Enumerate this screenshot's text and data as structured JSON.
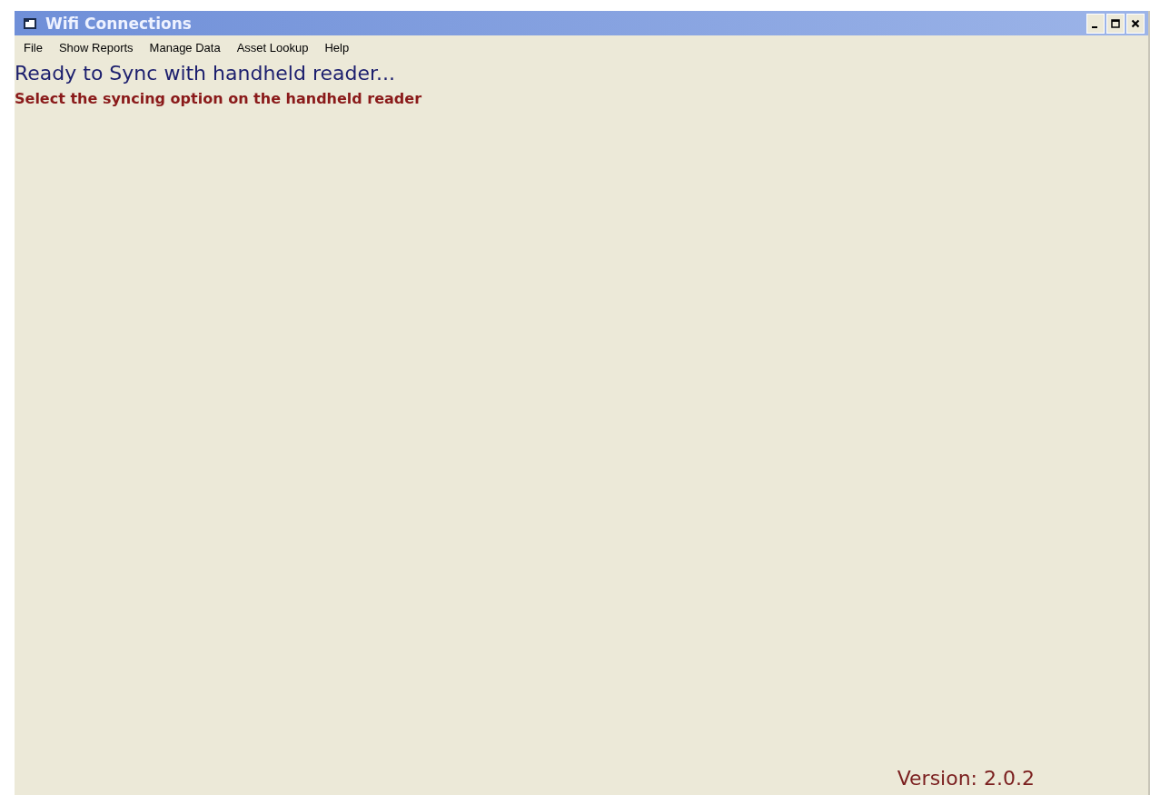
{
  "window": {
    "title": "Wifi Connections"
  },
  "menu": [
    "File",
    "Show Reports",
    "Manage Data",
    "Asset Lookup",
    "Help"
  ],
  "heading": "Ready to Sync with handheld reader...",
  "instruction": "Select the syncing option on the handheld reader",
  "version": "Version: 2.0.2"
}
